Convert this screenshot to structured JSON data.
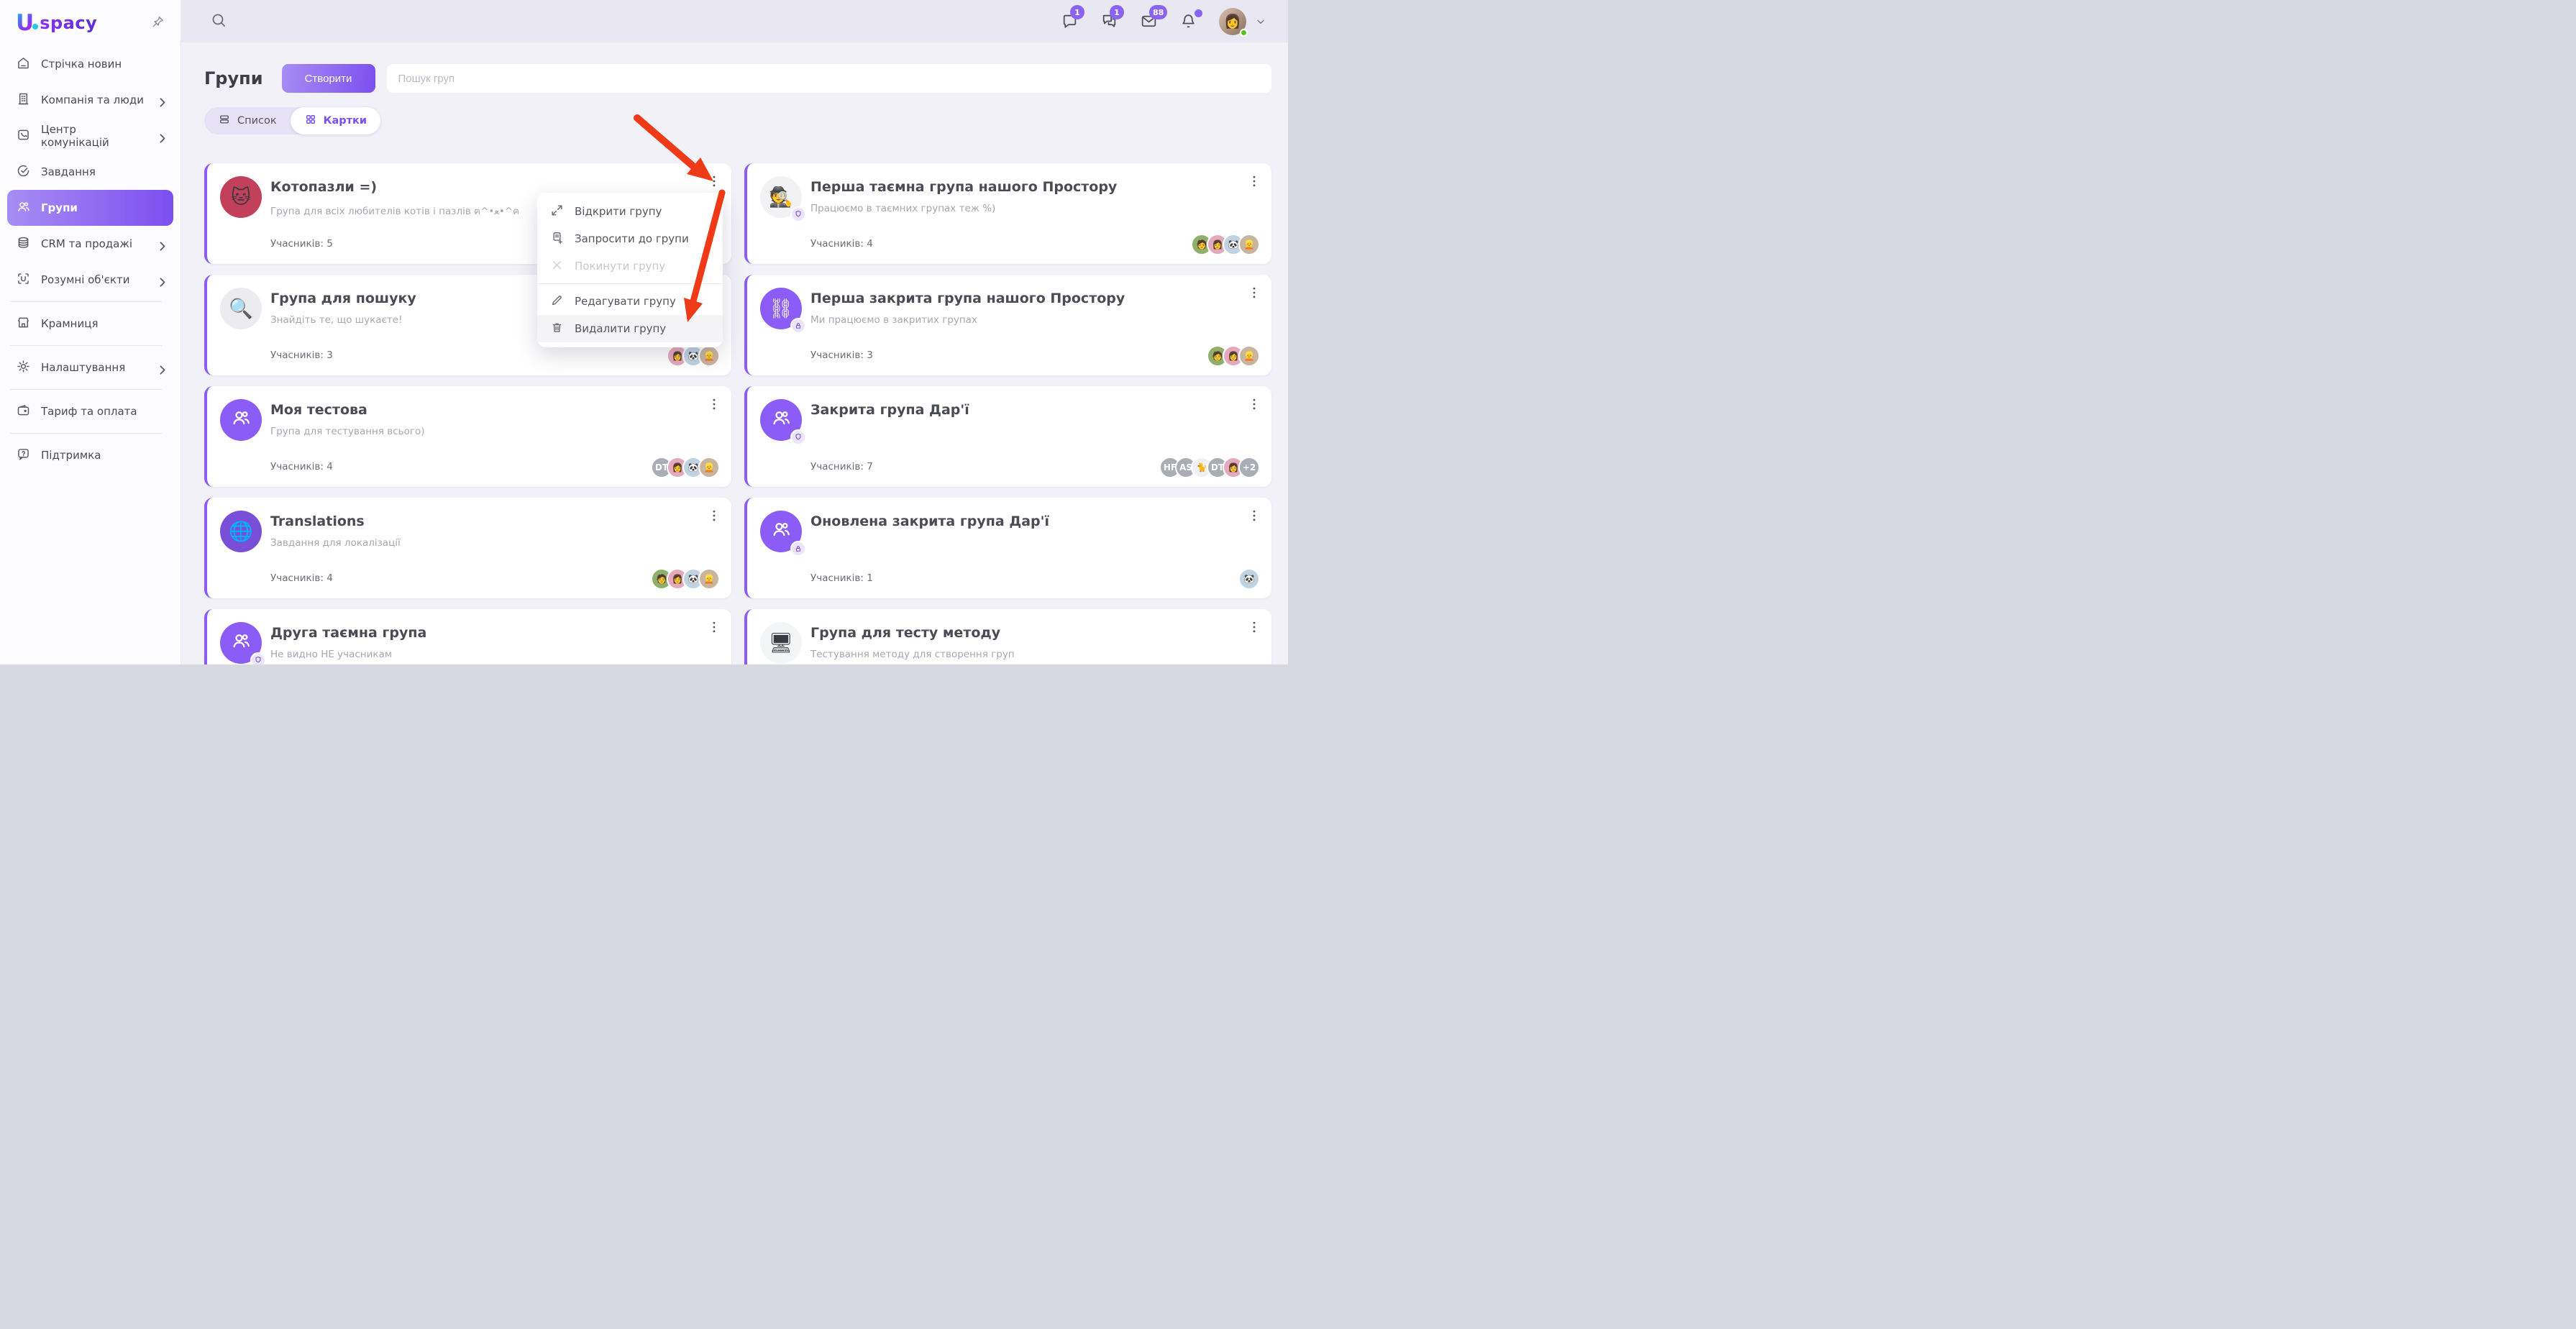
{
  "colors": {
    "accent": "#7c4ff0",
    "accent_2": "#a78df3",
    "annotation_red": "#ee3a17",
    "badge": "#8b63f2",
    "online": "#52c41a",
    "card_stripe": "#8b5cf6",
    "topbar_bg": "#e9e8f2",
    "content_bg": "#f2f1f8",
    "sidebar_bg": "#fcfcfe",
    "menu_hover": "#f4f4f7"
  },
  "logo": {
    "letter": "U",
    "brand": "spacy"
  },
  "sidebar": {
    "items": [
      {
        "label": "Стрічка новин"
      },
      {
        "label": "Компанія та люди"
      },
      {
        "label": "Центр комунікацій"
      },
      {
        "label": "Завдання"
      },
      {
        "label": "Групи"
      },
      {
        "label": "CRM та продажі"
      },
      {
        "label": "Розумні об'єкти"
      },
      {
        "label": "Крамниця"
      },
      {
        "label": "Налаштування"
      },
      {
        "label": "Тариф та оплата"
      },
      {
        "label": "Підтримка"
      }
    ]
  },
  "topbar": {
    "chat_badge": "1",
    "group_chat_badge": "1",
    "mail_badge": "88",
    "user_emoji": "👩"
  },
  "page": {
    "title": "Групи",
    "create_button": "Створити",
    "search_placeholder": "Пошук груп",
    "tab_list": "Список",
    "tab_cards": "Картки"
  },
  "cards": [
    {
      "title": "Котопазли =)",
      "desc": "Група для всіх любителів котів і пазлів ฅ^•ﻌ•^ฅ",
      "members": "Учасників: 5",
      "avatar_emoji": "🐱",
      "avatar_bg": "#c2405a",
      "member_avatars": []
    },
    {
      "title": "Перша таємна група нашого Простору",
      "desc": "Працюємо в таємних групах теж %)",
      "members": "Учасників: 4",
      "avatar_emoji": "🕵️",
      "avatar_bg": "#f2f2f4",
      "member_avatars": [
        {
          "t": "🧑",
          "bg": "#8fb06a"
        },
        {
          "t": "👩",
          "bg": "#e5a9bd"
        },
        {
          "t": "🐼",
          "bg": "#bfd3e2"
        },
        {
          "t": "👱",
          "bg": "#c9b49e"
        }
      ]
    },
    {
      "title": "Група для пошуку",
      "desc": "Знайдіть те, що шукаєте!",
      "members": "Учасників: 3",
      "avatar_emoji": "🔍",
      "avatar_bg": "#ececf0",
      "member_avatars": [
        {
          "t": "👩",
          "bg": "#e5a9bd"
        },
        {
          "t": "🐼",
          "bg": "#bfd3e2"
        },
        {
          "t": "👱",
          "bg": "#c9b49e"
        }
      ]
    },
    {
      "title": "Перша закрита група нашого Простору",
      "desc": "Ми працюємо в закритих групах",
      "members": "Учасників: 3",
      "avatar_emoji": "⛓",
      "avatar_bg": "#8b5cf6",
      "member_avatars": [
        {
          "t": "🧑",
          "bg": "#8fb06a"
        },
        {
          "t": "👩",
          "bg": "#e5a9bd"
        },
        {
          "t": "👱",
          "bg": "#c9b49e"
        }
      ]
    },
    {
      "title": "Моя тестова",
      "desc": "Група для тестування всього)",
      "members": "Учасників: 4",
      "avatar_emoji": "",
      "avatar_bg": "#8b5cf6",
      "member_avatars": [
        {
          "t": "DT",
          "bg": "#a9adb6"
        },
        {
          "t": "👩",
          "bg": "#e5a9bd"
        },
        {
          "t": "🐼",
          "bg": "#bfd3e2"
        },
        {
          "t": "👱",
          "bg": "#c9b49e"
        }
      ]
    },
    {
      "title": "Закрита група Дар'ї",
      "desc": "",
      "members": "Учасників: 7",
      "avatar_emoji": "",
      "avatar_bg": "#8b5cf6",
      "member_avatars": [
        {
          "t": "HF",
          "bg": "#a9adb6"
        },
        {
          "t": "AS",
          "bg": "#a9adb6"
        },
        {
          "t": "🐈",
          "bg": "#f0f0f2"
        },
        {
          "t": "DT",
          "bg": "#a9adb6"
        },
        {
          "t": "👩",
          "bg": "#e5a9bd"
        },
        {
          "t": "+2",
          "bg": "#a9adb6"
        }
      ]
    },
    {
      "title": "Translations",
      "desc": "Завдання для локалізації",
      "members": "Учасників: 4",
      "avatar_emoji": "🌐",
      "avatar_bg": "#7a4fd8",
      "member_avatars": [
        {
          "t": "🧑",
          "bg": "#8fb06a"
        },
        {
          "t": "👩",
          "bg": "#e5a9bd"
        },
        {
          "t": "🐼",
          "bg": "#bfd3e2"
        },
        {
          "t": "👱",
          "bg": "#c9b49e"
        }
      ]
    },
    {
      "title": "Оновлена закрита група Дар'ї",
      "desc": "",
      "members": "Учасників: 1",
      "avatar_emoji": "",
      "avatar_bg": "#8b5cf6",
      "member_avatars": [
        {
          "t": "🐼",
          "bg": "#bfd3e2"
        }
      ]
    },
    {
      "title": "Друга таємна група",
      "desc": "Не видно НЕ учасникам",
      "members": "",
      "avatar_emoji": "",
      "avatar_bg": "#8b5cf6",
      "member_avatars": []
    },
    {
      "title": "Група для тесту методу",
      "desc": "Тестування методу для створення груп",
      "members": "",
      "avatar_emoji": "🖥",
      "avatar_bg": "#f4f5f7",
      "member_avatars": []
    }
  ],
  "menu": {
    "open": "Відкрити групу",
    "invite": "Запросити до групи",
    "leave": "Покинути групу",
    "edit": "Редагувати групу",
    "delete": "Видалити групу"
  }
}
